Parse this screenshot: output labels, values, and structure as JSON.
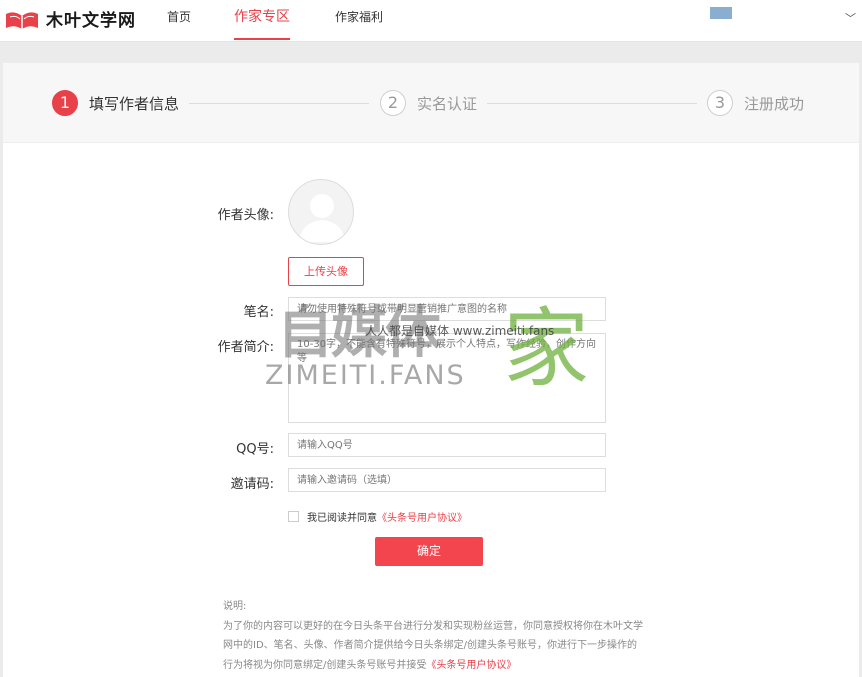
{
  "header": {
    "logo_text": "木叶文学网",
    "nav": [
      {
        "label": "首页"
      },
      {
        "label": "作家专区",
        "active": true
      },
      {
        "label": "作家福利"
      }
    ]
  },
  "steps": [
    {
      "num": "1",
      "label": "填写作者信息",
      "active": true
    },
    {
      "num": "2",
      "label": "实名认证",
      "active": false
    },
    {
      "num": "3",
      "label": "注册成功",
      "active": false
    }
  ],
  "form": {
    "avatar_label": "作者头像:",
    "upload_label": "上传头像",
    "penname_label": "笔名:",
    "penname_placeholder": "请勿使用特殊符号或带明显营销推广意图的名称",
    "bio_label": "作者简介:",
    "bio_placeholder": "10-30字，不能含有特殊符号，展示个人特点，写作经验，创作方向等",
    "qq_label": "QQ号:",
    "qq_placeholder": "请输入QQ号",
    "invite_label": "邀请码:",
    "invite_placeholder": "请输入邀请码（选填）",
    "agree_text": "我已阅读并同意",
    "agree_link": "《头条号用户协议》",
    "confirm_label": "确定"
  },
  "notes": {
    "title": "说明:",
    "body": "为了你的内容可以更好的在今日头条平台进行分发和实现粉丝运营，你同意授权将你在木叶文学网中的ID、笔名、头像、作者简介提供给今日头条绑定/创建头条号账号，你进行下一步操作的行为将视为你同意绑定/创建头条号账号并接受",
    "link": "《头条号用户协议》"
  },
  "watermark": {
    "cn": "自媒体",
    "jia": "家",
    "en": "ZIMEITI.FANS",
    "small": "人人都是自媒体  www.zimeiti.fans"
  },
  "colors": {
    "accent": "#e9414a",
    "watermark_green": "#6eaf3c"
  }
}
